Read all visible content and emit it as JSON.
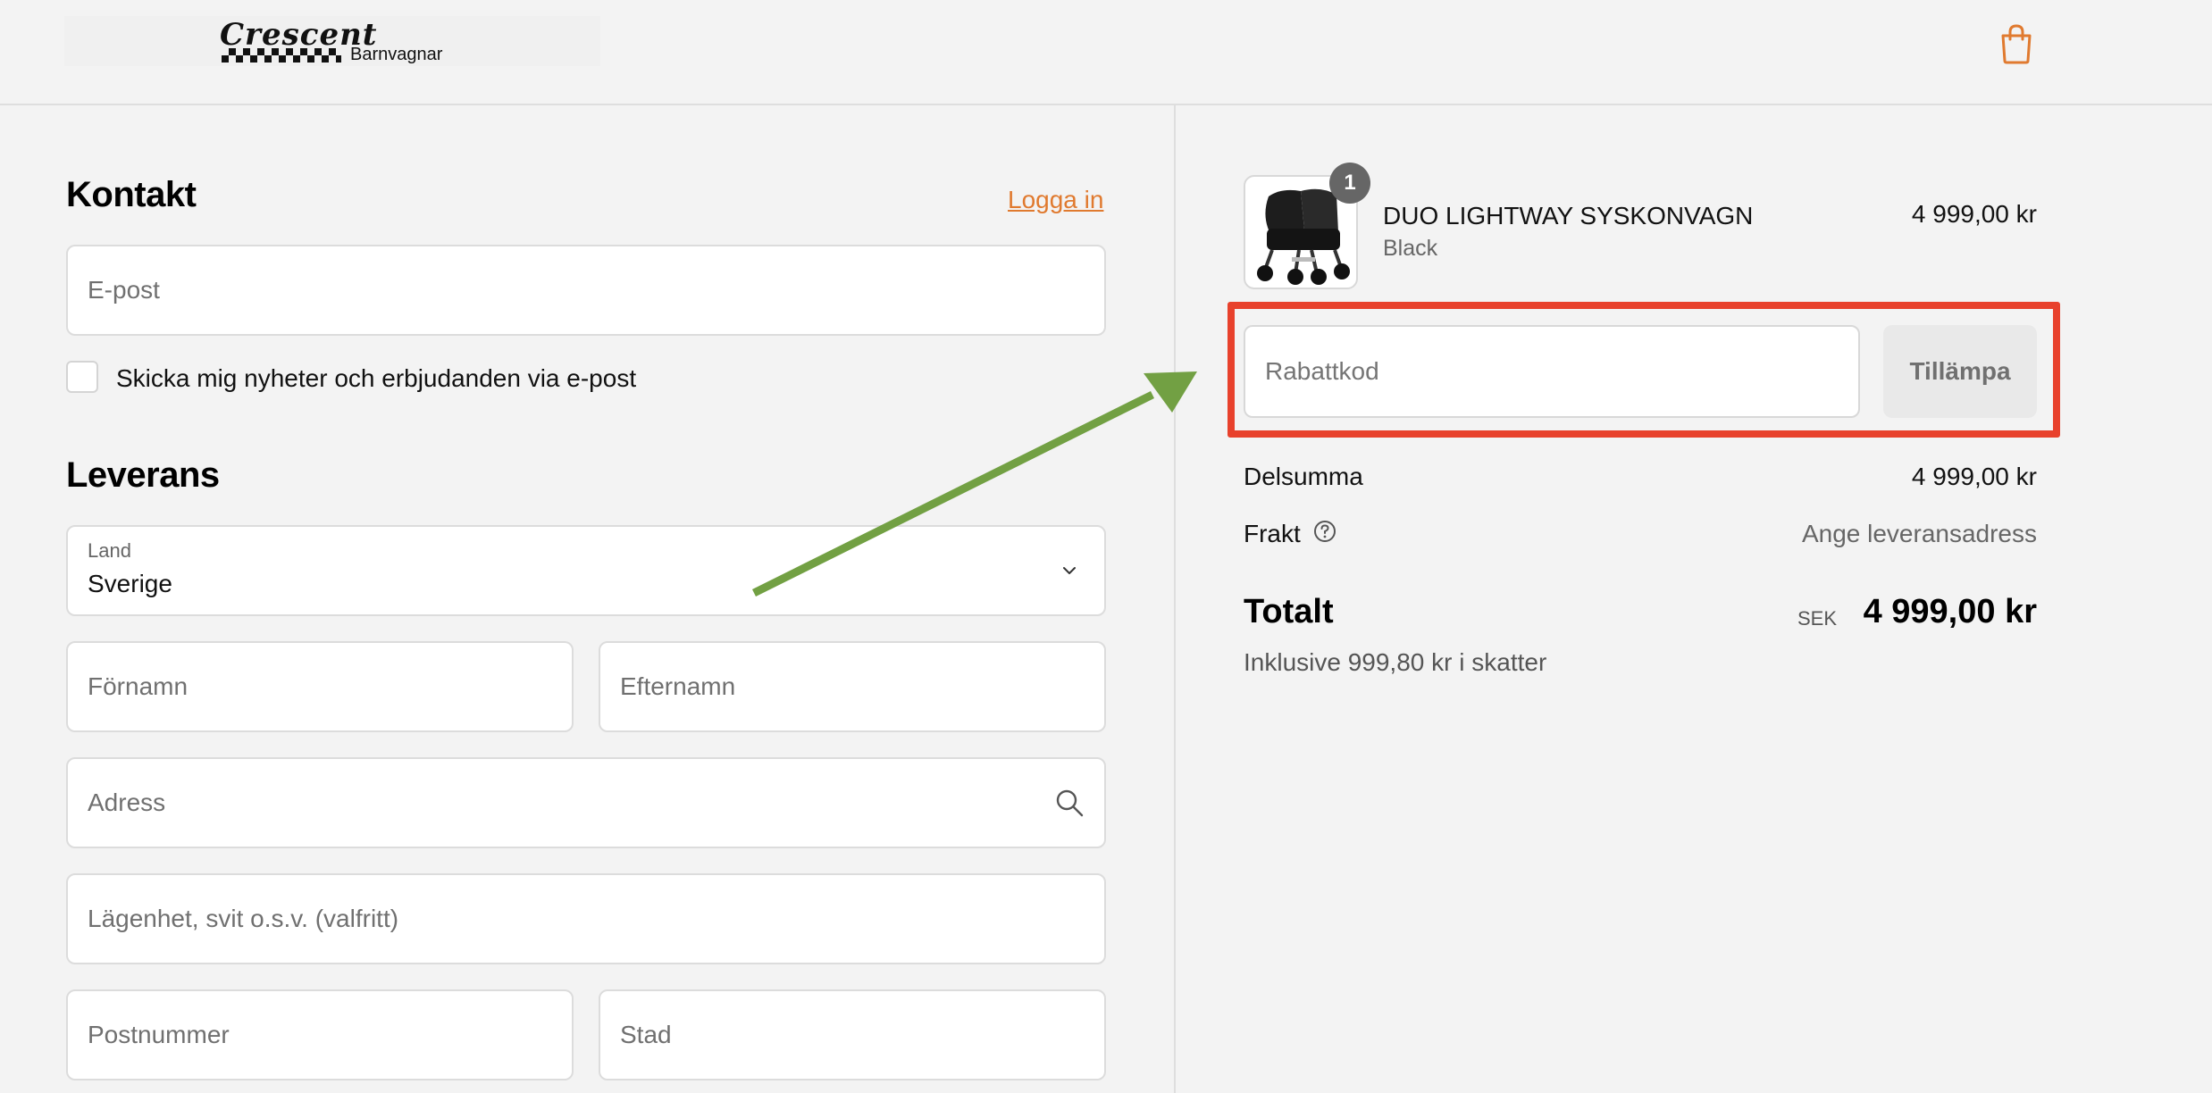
{
  "header": {
    "logo_script": "Crescent",
    "logo_sub": "Barnvagnar",
    "cart_icon": "shopping-bag-icon"
  },
  "contact": {
    "heading": "Kontakt",
    "login_link": "Logga in",
    "email_placeholder": "E-post",
    "newsletter_label": "Skicka mig nyheter och erbjudanden via e-post"
  },
  "delivery": {
    "heading": "Leverans",
    "country_label": "Land",
    "country_value": "Sverige",
    "first_name_placeholder": "Förnamn",
    "last_name_placeholder": "Efternamn",
    "address_placeholder": "Adress",
    "apartment_placeholder": "Lägenhet, svit o.s.v. (valfritt)",
    "postal_code_placeholder": "Postnummer",
    "city_placeholder": "Stad"
  },
  "summary": {
    "product": {
      "quantity": "1",
      "name": "DUO LIGHTWAY SYSKONVAGN",
      "variant": "Black",
      "price": "4 999,00 kr"
    },
    "discount_placeholder": "Rabattkod",
    "apply_label": "Tillämpa",
    "subtotal_label": "Delsumma",
    "subtotal_value": "4 999,00 kr",
    "shipping_label": "Frakt",
    "shipping_value": "Ange leveransadress",
    "total_label": "Totalt",
    "currency": "SEK",
    "total_value": "4 999,00 kr",
    "tax_note": "Inklusive 999,80 kr i skatter"
  },
  "colors": {
    "accent": "#e07a2f",
    "highlight": "#e8412c",
    "arrow": "#72a043"
  }
}
